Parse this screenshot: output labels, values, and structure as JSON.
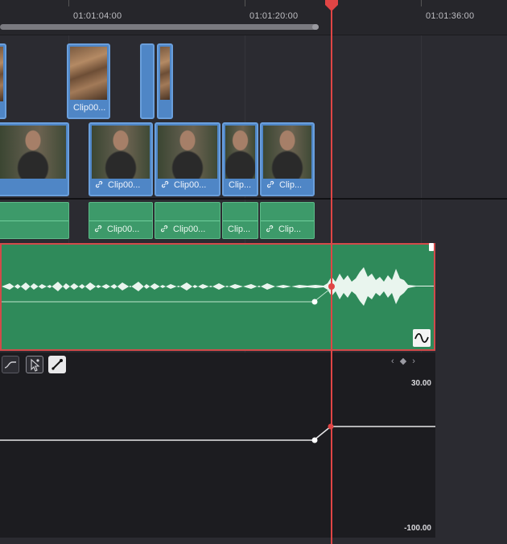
{
  "ruler": {
    "timecodes": [
      "01:01:04:00",
      "01:01:20:00",
      "01:01:36:00"
    ]
  },
  "video_track_upper": {
    "clips": [
      {
        "label": "Clip00..."
      }
    ]
  },
  "video_track_lower": {
    "clips": [
      {
        "label": "Clip00..."
      },
      {
        "label": "Clip00..."
      },
      {
        "label": "Clip..."
      },
      {
        "label": "Clip..."
      }
    ]
  },
  "audio_linked": {
    "clips": [
      {
        "label": "Clip00..."
      },
      {
        "label": "Clip00..."
      },
      {
        "label": "Clip..."
      },
      {
        "label": "Clip..."
      }
    ]
  },
  "keyframe_editor": {
    "max_value": "30.00",
    "min_value": "-100.00",
    "nav": "‹ ◆ ›"
  },
  "colors": {
    "video_clip": "#4f86c6",
    "audio_clip": "#2f8a5a",
    "playhead": "#e04545",
    "selection_border": "#d24a4a"
  },
  "icons": {
    "link": "link-icon",
    "fade_curve": "fade-curve-icon",
    "curve_tool": "curve-tool-icon",
    "pointer_tool": "pointer-tool-icon",
    "pen_tool": "pen-tool-icon"
  }
}
